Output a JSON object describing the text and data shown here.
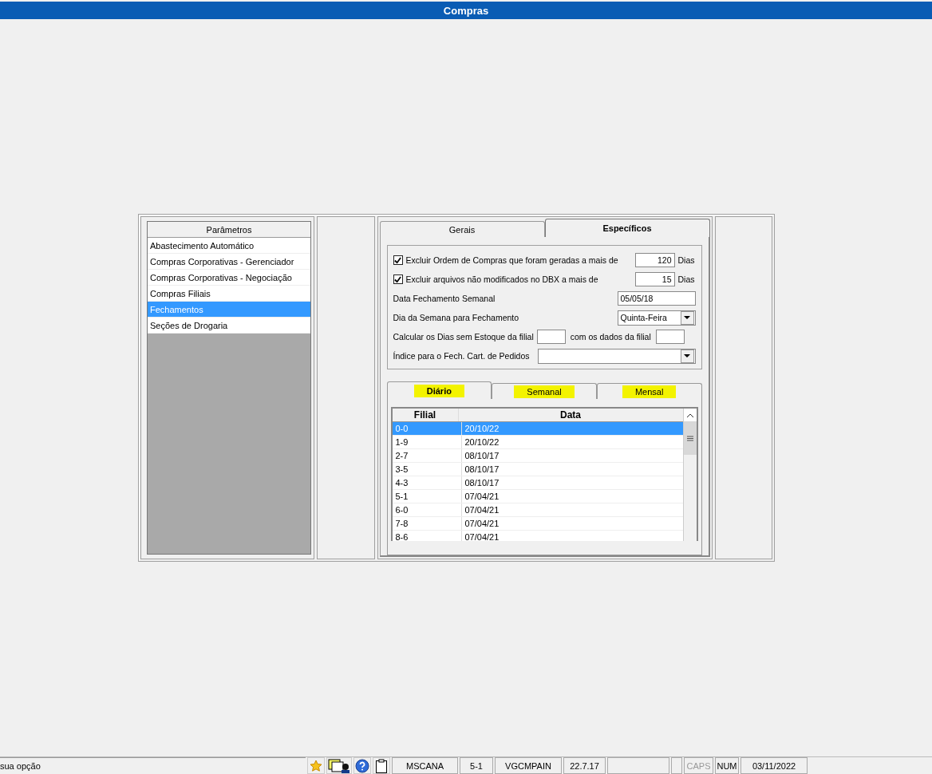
{
  "window": {
    "title": "Compras"
  },
  "sidebar": {
    "header": "Parâmetros",
    "items": [
      {
        "label": "Abastecimento Automático",
        "selected": false
      },
      {
        "label": "Compras Corporativas - Gerenciador",
        "selected": false
      },
      {
        "label": "Compras Corporativas - Negociação",
        "selected": false
      },
      {
        "label": "Compras Filiais",
        "selected": false
      },
      {
        "label": "Fechamentos",
        "selected": true
      },
      {
        "label": "Seções de Drogaria",
        "selected": false
      }
    ]
  },
  "tabs": [
    {
      "label": "Gerais",
      "selected": false
    },
    {
      "label": "Específicos",
      "selected": true
    }
  ],
  "form": {
    "exclude_orders": {
      "checked": true,
      "label": "Excluir Ordem de Compras que foram geradas a mais de",
      "value": "120",
      "unit": "Dias"
    },
    "exclude_files": {
      "checked": true,
      "label": "Excluir arquivos não modificados no DBX a mais de",
      "value": "15",
      "unit": "Dias"
    },
    "weekly_date": {
      "label": "Data Fechamento Semanal",
      "value": "05/05/18"
    },
    "weekday": {
      "label": "Dia da Semana para Fechamento",
      "value": "Quinta-Feira"
    },
    "stock_days": {
      "label": "Calcular os Dias sem Estoque da filial",
      "label2": "com os dados da filial"
    },
    "index": {
      "label": "Índice para o Fech. Cart. de Pedidos"
    }
  },
  "sub_tabs": [
    {
      "label": "Diário",
      "selected": true,
      "highlighted": true
    },
    {
      "label": "Semanal",
      "selected": false,
      "highlighted": true
    },
    {
      "label": "Mensal",
      "selected": false,
      "highlighted": true
    }
  ],
  "table": {
    "columns": [
      "Filial",
      "Data"
    ],
    "rows": [
      {
        "cells": [
          "0-0",
          "20/10/22"
        ],
        "selected": true
      },
      {
        "cells": [
          "1-9",
          "20/10/22"
        ],
        "selected": false
      },
      {
        "cells": [
          "2-7",
          "08/10/17"
        ],
        "selected": false
      },
      {
        "cells": [
          "3-5",
          "08/10/17"
        ],
        "selected": false
      },
      {
        "cells": [
          "4-3",
          "08/10/17"
        ],
        "selected": false
      },
      {
        "cells": [
          "5-1",
          "07/04/21"
        ],
        "selected": false
      },
      {
        "cells": [
          "6-0",
          "07/04/21"
        ],
        "selected": false
      },
      {
        "cells": [
          "7-8",
          "07/04/21"
        ],
        "selected": false
      },
      {
        "cells": [
          "8-6",
          "07/04/21"
        ],
        "selected": false
      }
    ]
  },
  "status_bar": {
    "message": "sua opção",
    "fields": [
      {
        "text": "MSCANA",
        "enabled": true
      },
      {
        "text": "5-1",
        "enabled": true
      },
      {
        "text": "VGCMPAIN",
        "enabled": true
      },
      {
        "text": "22.7.17",
        "enabled": true
      },
      {
        "text": "CAPS",
        "enabled": false
      },
      {
        "text": "NUM",
        "enabled": true
      },
      {
        "text": "03/11/2022",
        "enabled": true
      }
    ]
  }
}
